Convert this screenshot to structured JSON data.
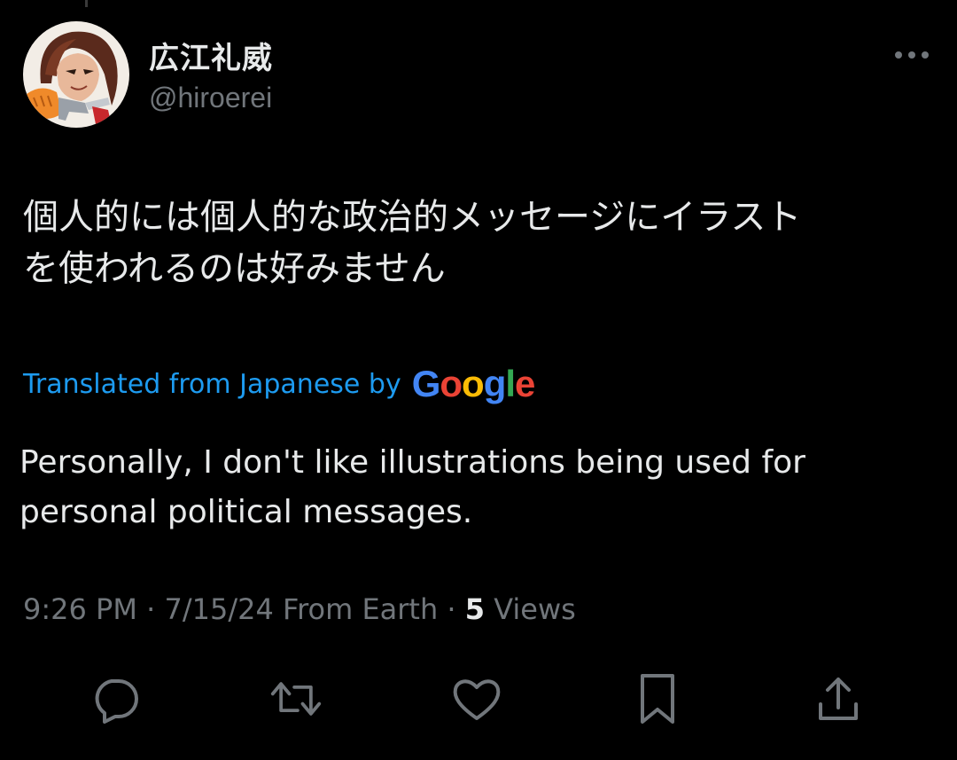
{
  "author": {
    "display_name": "広江礼威",
    "handle": "@hiroerei"
  },
  "tweet": {
    "text_line1": "個人的には個人的な政治的メッセージにイラスト",
    "text_line2": "を使われるのは好みません",
    "translated_label": "Translated from Japanese by",
    "translation_line1": "Personally, I don't like illustrations being used for",
    "translation_line2": "personal political messages."
  },
  "google_logo": {
    "letters": [
      "G",
      "o",
      "o",
      "g",
      "l",
      "e"
    ],
    "colors": [
      "#4285F4",
      "#EA4335",
      "#FBBC05",
      "#4285F4",
      "#34A853",
      "#EA4335"
    ]
  },
  "meta": {
    "time": "9:26 PM",
    "separator": "·",
    "date": "7/15/24",
    "source": "From Earth",
    "views_count": "5",
    "views_label": "Views"
  },
  "actions": [
    "reply",
    "retweet",
    "like",
    "bookmark",
    "share"
  ],
  "colors": {
    "background": "#000000",
    "text": "#e7e9ea",
    "secondary": "#71767b",
    "link": "#1d9bf0"
  }
}
